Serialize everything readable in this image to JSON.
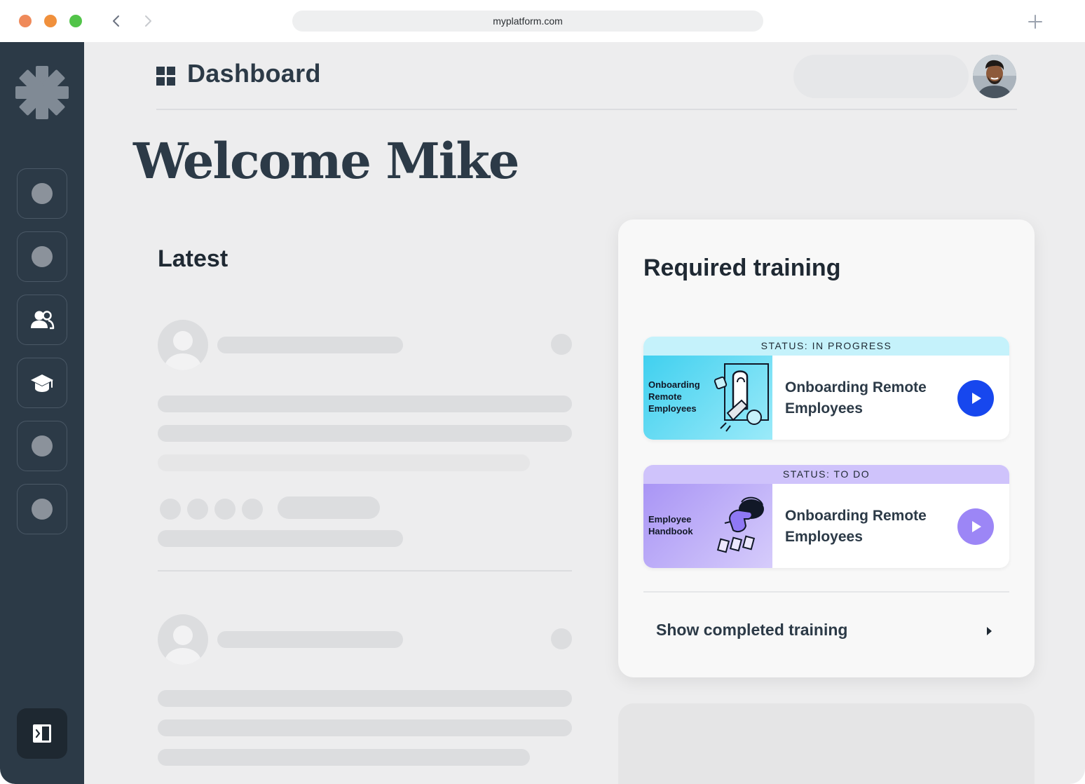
{
  "browser": {
    "url": "myplatform.com"
  },
  "header": {
    "title": "Dashboard"
  },
  "welcome": "Welcome Mike",
  "latest": {
    "title": "Latest"
  },
  "sidebar": {
    "items": [
      {
        "icon": "placeholder-dot"
      },
      {
        "icon": "placeholder-dot"
      },
      {
        "icon": "users-icon"
      },
      {
        "icon": "graduation-cap-icon"
      },
      {
        "icon": "placeholder-dot"
      },
      {
        "icon": "placeholder-dot"
      }
    ],
    "collapse_icon": "sidebar-collapse-icon"
  },
  "training": {
    "title": "Required training",
    "items": [
      {
        "status": "STATUS: IN PROGRESS",
        "thumb_label": "Onboarding Remote Employees",
        "name": "Onboarding Remote Employees",
        "status_color": "#c5f2fb",
        "play_color": "#1747ee"
      },
      {
        "status": "STATUS: TO DO",
        "thumb_label": "Employee Handbook",
        "name": "Onboarding Remote Employees",
        "status_color": "#cfc3fb",
        "play_color": "#9c86f6"
      }
    ],
    "show_completed": "Show completed training"
  },
  "colors": {
    "sidebar": "#2c3a47",
    "background": "#ededee",
    "accent_blue": "#1747ee",
    "accent_purple": "#9c86f6"
  }
}
